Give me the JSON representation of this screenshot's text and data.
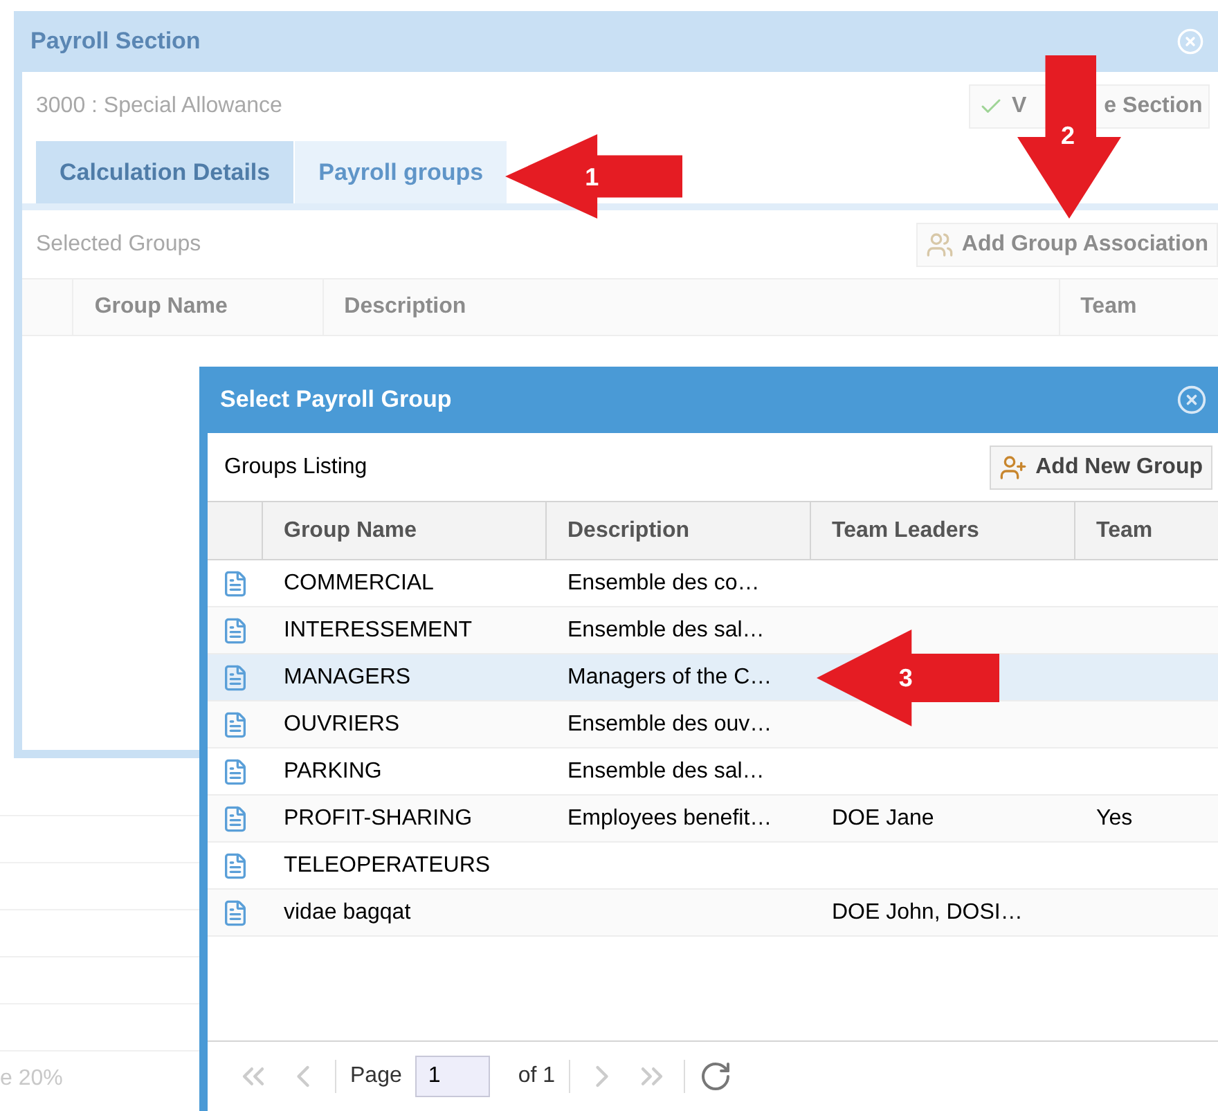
{
  "background_page": {
    "footer_text": "e 20%"
  },
  "payroll_section": {
    "title": "Payroll Section",
    "subtitle": "3000 : Special Allowance",
    "validate_button": {
      "label_parts": [
        "V",
        "e Section"
      ]
    },
    "tabs": [
      {
        "label": "Calculation Details",
        "selected": false
      },
      {
        "label": "Payroll groups",
        "selected": true
      }
    ],
    "toolbar_title": "Selected Groups",
    "add_button": "Add Group Association",
    "columns": [
      "Group Name",
      "Description",
      "Team"
    ]
  },
  "select_dialog": {
    "title": "Select Payroll Group",
    "toolbar_title": "Groups Listing",
    "add_button": "Add New Group",
    "columns": [
      "Group Name",
      "Description",
      "Team Leaders",
      "Team"
    ],
    "rows": [
      {
        "group_name": "COMMERCIAL",
        "description": "Ensemble des co…",
        "selected": false
      },
      {
        "group_name": "INTERESSEMENT",
        "description": "Ensemble des sal…",
        "selected": false
      },
      {
        "group_name": "MANAGERS",
        "description": "Managers of the C…",
        "selected": true
      },
      {
        "group_name": "OUVRIERS",
        "description": "Ensemble des ouv…",
        "selected": false
      },
      {
        "group_name": "PARKING",
        "description": "Ensemble des sal…",
        "selected": false
      },
      {
        "group_name": "PROFIT-SHARING",
        "description": "Employees benefit…",
        "team_leaders": "DOE Jane",
        "team": "Yes",
        "selected": false
      },
      {
        "group_name": "TELEOPERATEURS",
        "selected": false
      },
      {
        "group_name": "vidae bagqat",
        "team_leaders": "DOE John, DOSI…",
        "selected": false
      }
    ],
    "pager": {
      "page_label": "Page",
      "page_value": "1",
      "of_label": "of 1"
    }
  },
  "annotations": [
    {
      "number": "1",
      "kind": "left"
    },
    {
      "number": "2",
      "kind": "down"
    },
    {
      "number": "3",
      "kind": "left"
    }
  ]
}
